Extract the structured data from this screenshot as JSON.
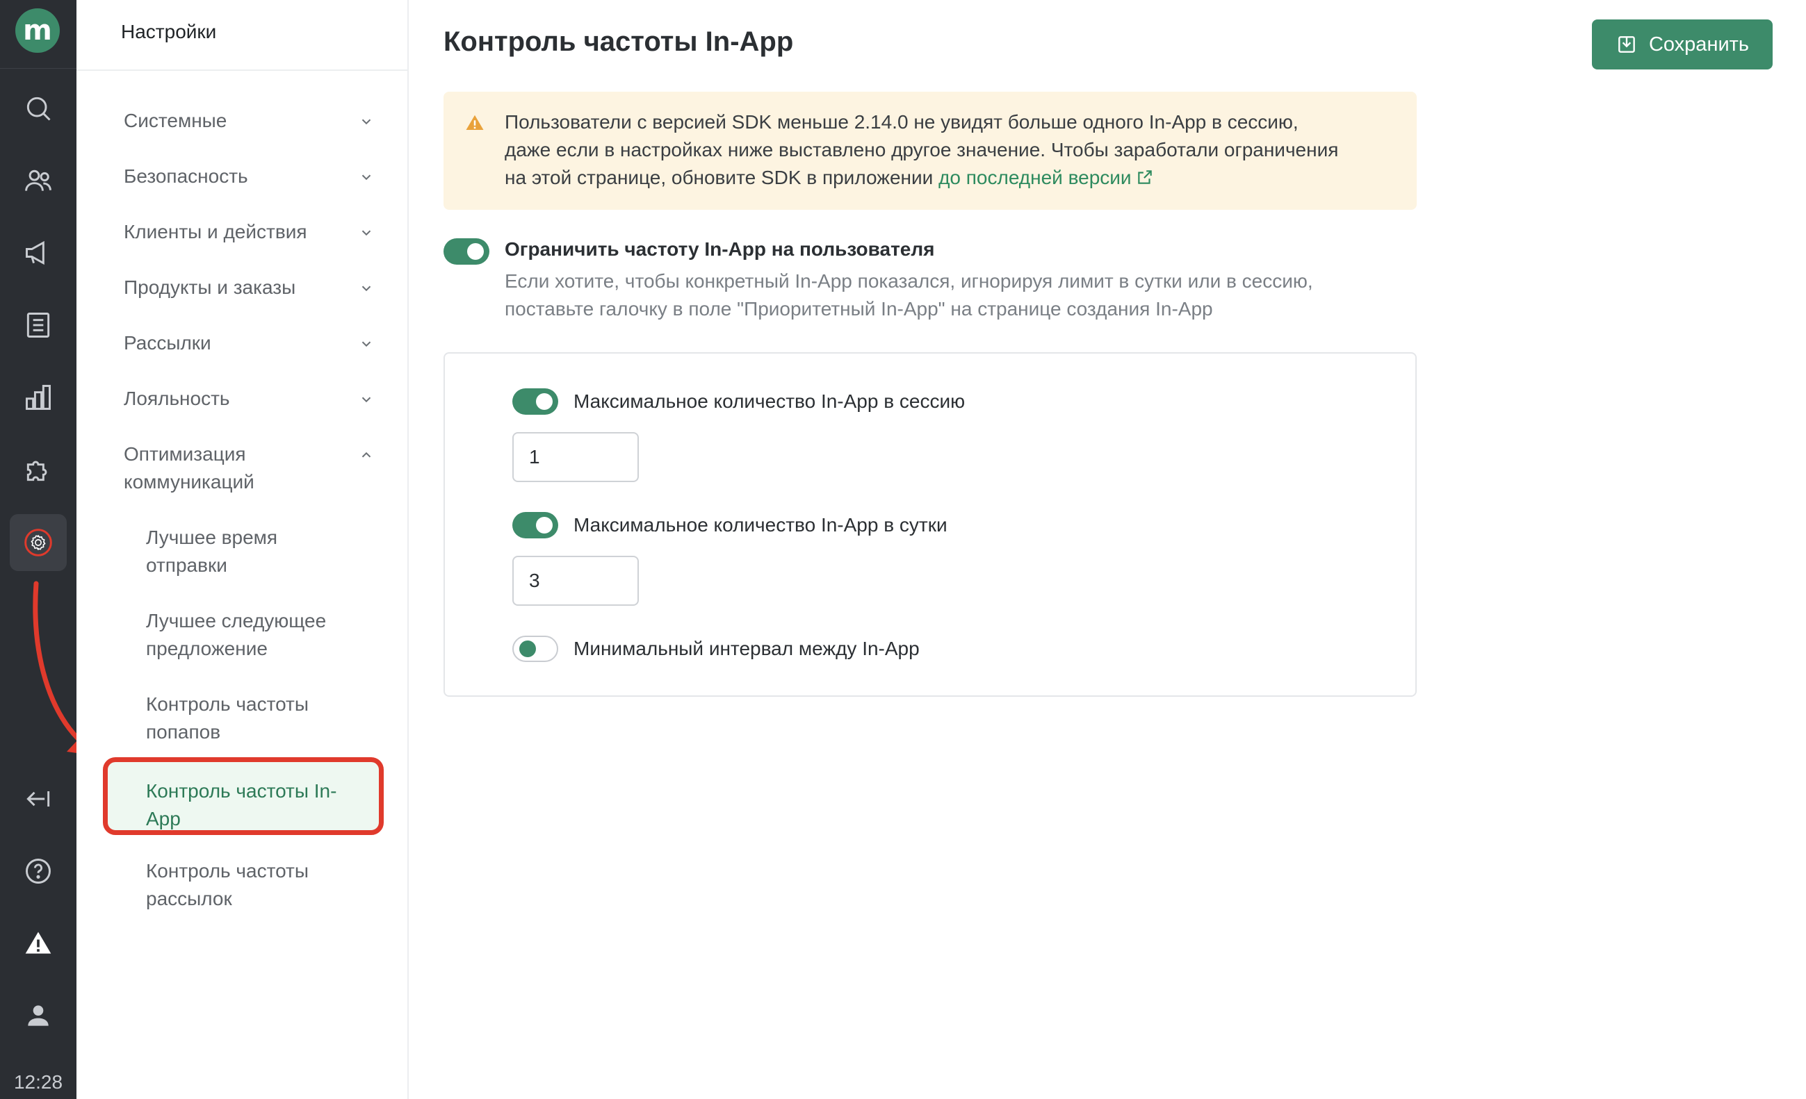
{
  "rail": {
    "logo_letter": "m",
    "clock": "12:28",
    "icons": [
      "search-icon",
      "users-icon",
      "megaphone-icon",
      "document-icon",
      "chart-icon",
      "puzzle-icon",
      "gear-icon",
      "collapse-icon",
      "help-icon",
      "warning-icon",
      "user-icon"
    ]
  },
  "nav": {
    "title": "Настройки",
    "items": [
      {
        "label": "Системные"
      },
      {
        "label": "Безопасность"
      },
      {
        "label": "Клиенты и действия"
      },
      {
        "label": "Продукты и заказы"
      },
      {
        "label": "Рассылки"
      },
      {
        "label": "Лояльность"
      },
      {
        "label_line1": "Оптимизация",
        "label_line2": "коммуникаций"
      }
    ],
    "subitems": [
      {
        "line1": "Лучшее время",
        "line2": "отправки"
      },
      {
        "line1": "Лучшее следующее",
        "line2": "предложение"
      },
      {
        "line1": "Контроль частоты",
        "line2": "попапов"
      },
      {
        "line1": "Контроль частоты In-",
        "line2": "App"
      },
      {
        "line1": "Контроль частоты",
        "line2": "рассылок"
      }
    ]
  },
  "main": {
    "title": "Контроль частоты In-App",
    "save_label": "Сохранить",
    "warning": {
      "line1": "Пользователи с версией SDK меньше 2.14.0 не увидят больше одного In-App в сессию,",
      "line2": "даже если в настройках ниже выставлено другое значение. Чтобы заработали ограничения",
      "line3": "на этой странице, обновите SDK в приложении",
      "link": "до последней версии"
    },
    "limit_toggle_label": "Ограничить частоту In-App на пользователя",
    "limit_desc_line1": "Если хотите, чтобы конкретный In-App показался, игнорируя лимит в сутки или в сессию,",
    "limit_desc_line2": "поставьте галочку в поле \"Приоритетный In-App\" на странице создания In-App",
    "session_label": "Максимальное количество In-App в сессию",
    "session_value": "1",
    "day_label": "Максимальное количество In-App в сутки",
    "day_value": "3",
    "interval_label": "Минимальный интервал между In-App"
  },
  "colors": {
    "accent": "#3d8b6a",
    "rail_bg": "#2b2e33",
    "warning_bg": "#fdf4e1",
    "highlight": "#e03a2c"
  }
}
